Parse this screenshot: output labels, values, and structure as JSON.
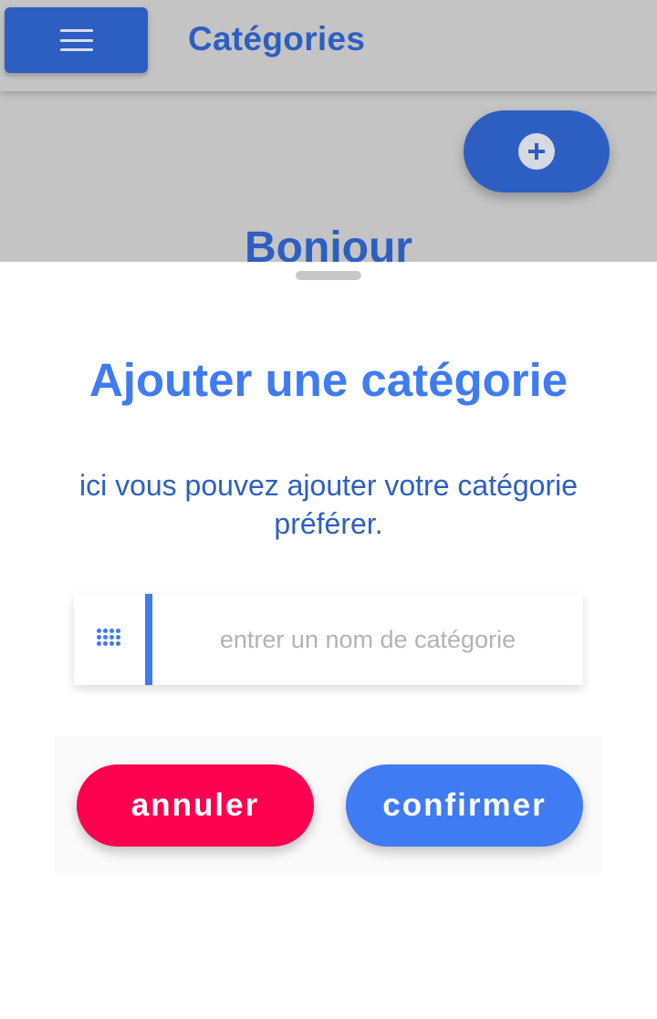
{
  "appbar": {
    "title": "Catégories",
    "menu_icon": "menu-icon"
  },
  "page": {
    "heading_partial": "Bonjour",
    "fab_icon": "add-circle-icon"
  },
  "sheet": {
    "title": "Ajouter une catégorie",
    "description": "ici vous pouvez ajouter votre catégorie préférer.",
    "input": {
      "icon": "grid-dots-icon",
      "placeholder": "entrer un nom de catégorie",
      "value": ""
    },
    "cancel_label": "annuler",
    "confirm_label": "confirmer"
  },
  "colors": {
    "primary": "#3f7bf2",
    "primary_dark": "#2d5fc2",
    "danger": "#fe0050",
    "scrim": "#c4c4c4"
  }
}
